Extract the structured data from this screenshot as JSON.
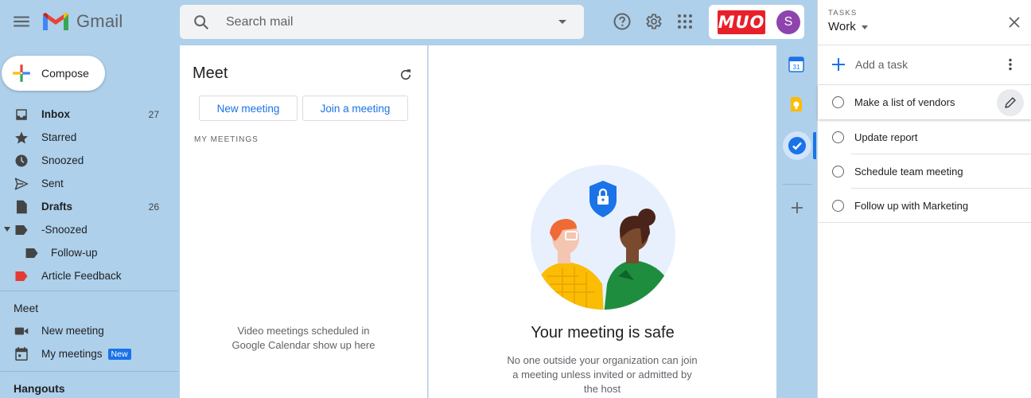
{
  "header": {
    "app_name": "Gmail",
    "search_placeholder": "Search mail",
    "brand_text": "MUO",
    "avatar_initial": "S"
  },
  "compose": {
    "label": "Compose"
  },
  "sidebar": {
    "items": [
      {
        "label": "Inbox",
        "count": "27",
        "icon": "inbox-icon",
        "bold": true
      },
      {
        "label": "Starred",
        "count": "",
        "icon": "star-icon"
      },
      {
        "label": "Snoozed",
        "count": "",
        "icon": "clock-icon"
      },
      {
        "label": "Sent",
        "count": "",
        "icon": "send-icon"
      },
      {
        "label": "Drafts",
        "count": "26",
        "icon": "draft-icon",
        "bold": true
      },
      {
        "label": "-Snoozed",
        "count": "",
        "icon": "label-icon"
      },
      {
        "label": "Follow-up",
        "count": "",
        "icon": "label-icon"
      },
      {
        "label": "Article Feedback",
        "count": "",
        "icon": "label-icon",
        "color": "#e53935"
      }
    ],
    "meet": {
      "title": "Meet",
      "items": [
        {
          "label": "New meeting",
          "icon": "video-icon"
        },
        {
          "label": "My meetings",
          "icon": "calendar-icon",
          "badge": "New"
        }
      ]
    },
    "hangouts_title": "Hangouts"
  },
  "meet_panel": {
    "title": "Meet",
    "new_meeting": "New meeting",
    "join_meeting": "Join a meeting",
    "section": "MY MEETINGS",
    "empty_line1": "Video meetings scheduled in",
    "empty_line2": "Google Calendar show up here"
  },
  "safe_panel": {
    "title": "Your meeting is safe",
    "desc_line1": "No one outside your organization can join",
    "desc_line2": "a meeting unless invited or admitted by",
    "desc_line3": "the host"
  },
  "side_apps": {
    "calendar_day": "31"
  },
  "tasks": {
    "label": "TASKS",
    "list_name": "Work",
    "add_label": "Add a task",
    "items": [
      "Make a list of vendors",
      "Update report",
      "Schedule team meeting",
      "Follow up with Marketing"
    ]
  },
  "colors": {
    "background": "#aed0ea",
    "accent": "#1a73e8",
    "brand_red": "#e8202a",
    "avatar": "#8e44ad"
  }
}
